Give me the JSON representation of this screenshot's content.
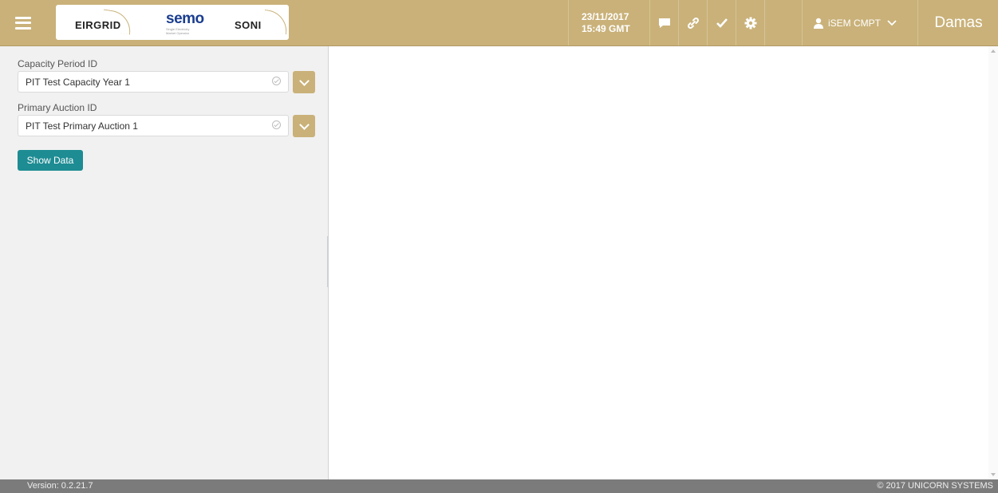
{
  "header": {
    "logos": {
      "eirgrid": "EIRGRID",
      "semo": "semo",
      "semo_sub": "Single Electricity Market Operator",
      "soni": "SONI"
    },
    "date": "23/11/2017",
    "time": "15:49 GMT",
    "tools": [
      "chat-icon",
      "link-icon",
      "check-icon",
      "gear-icon"
    ],
    "user": "iSEM CMPT",
    "brand": "Damas",
    "accent_color": "#c9b179"
  },
  "sidebar": {
    "capacity_period": {
      "label": "Capacity Period ID",
      "value": "PIT Test Capacity Year 1"
    },
    "primary_auction": {
      "label": "Primary Auction ID",
      "value": "PIT Test Primary Auction 1"
    },
    "show_button": "Show Data",
    "button_color": "#1d8c93"
  },
  "footer": {
    "version": "Version: 0.2.21.7",
    "copyright": "© 2017 UNICORN SYSTEMS"
  }
}
